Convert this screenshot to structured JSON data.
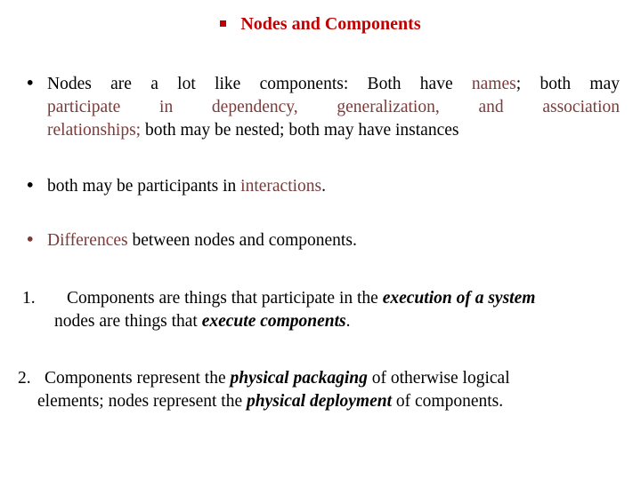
{
  "title": {
    "text": "Nodes and Components",
    "color": "#c00000"
  },
  "bullets": [
    {
      "line1_parts": [
        "Nodes are a lot like components: Both have ",
        "names",
        "; both may"
      ],
      "line2": "participate in dependency, generalization, and association",
      "line3_parts": [
        "relationships;",
        " both may be nested; both may have instances"
      ]
    },
    {
      "parts": [
        "both may be participants in ",
        "interactions",
        "."
      ]
    },
    {
      "parts": [
        "Differences",
        " between nodes and components."
      ]
    }
  ],
  "numbered": [
    {
      "number": "1.",
      "line1_parts": [
        "Components are things that participate in the ",
        "execution of a system"
      ],
      "line2_parts": [
        "nodes are things that ",
        "execute components",
        "."
      ]
    },
    {
      "number": "2.",
      "line1_parts": [
        "Components represent the ",
        "physical packaging",
        " of otherwise logical"
      ],
      "line2_parts": [
        "elements; nodes represent the ",
        "physical deployment",
        " of components."
      ]
    }
  ],
  "colors": {
    "highlight": "#7a3b3b",
    "title": "#c00000"
  }
}
